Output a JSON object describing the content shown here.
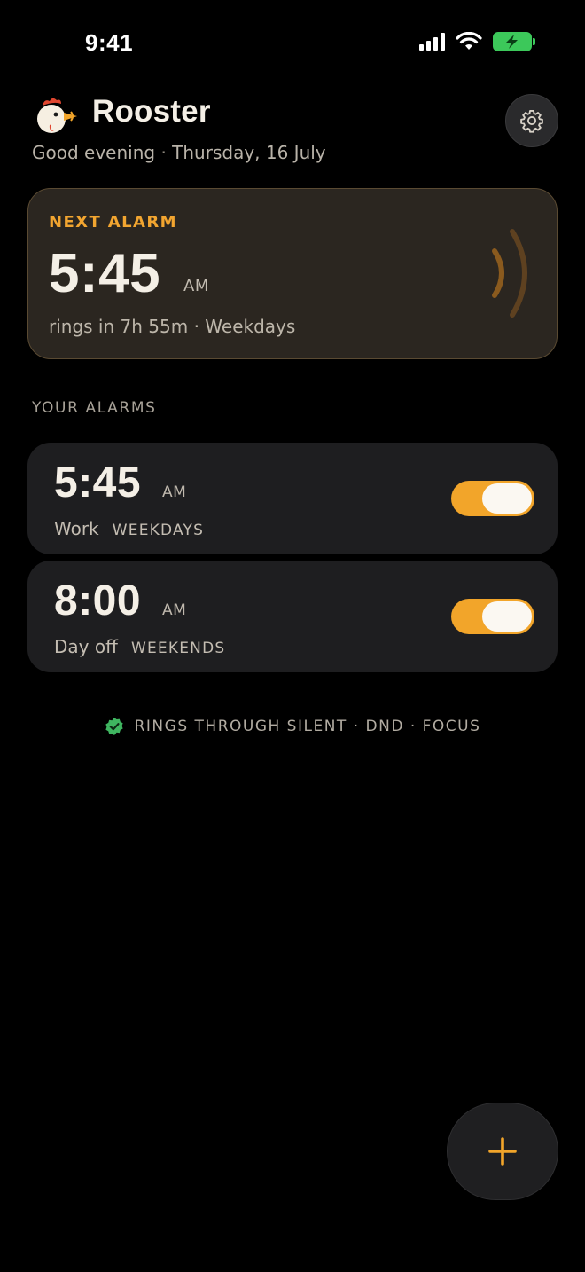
{
  "status_bar": {
    "time": "9:41"
  },
  "header": {
    "title": "Rooster",
    "greeting": "Good evening",
    "date": "Thursday, 16 July"
  },
  "next_alarm": {
    "label": "NEXT ALARM",
    "time": "5:45",
    "ampm": "AM",
    "countdown": "rings in 7h 55m",
    "repeat": "Weekdays"
  },
  "alarms_section": {
    "label": "YOUR ALARMS",
    "items": [
      {
        "time": "5:45",
        "ampm": "AM",
        "label": "Work",
        "days": "WEEKDAYS",
        "enabled": true
      },
      {
        "time": "8:00",
        "ampm": "AM",
        "label": "Day off",
        "days": "WEEKENDS",
        "enabled": true
      }
    ]
  },
  "silent_note": {
    "text": "RINGS THROUGH SILENT · DND · FOCUS",
    "icon": "verified-check-icon"
  },
  "colors": {
    "accent": "#f2a52a",
    "card_bg": "#1e1e20",
    "next_card_bg": "#2b2620",
    "check_green": "#3fb560"
  }
}
